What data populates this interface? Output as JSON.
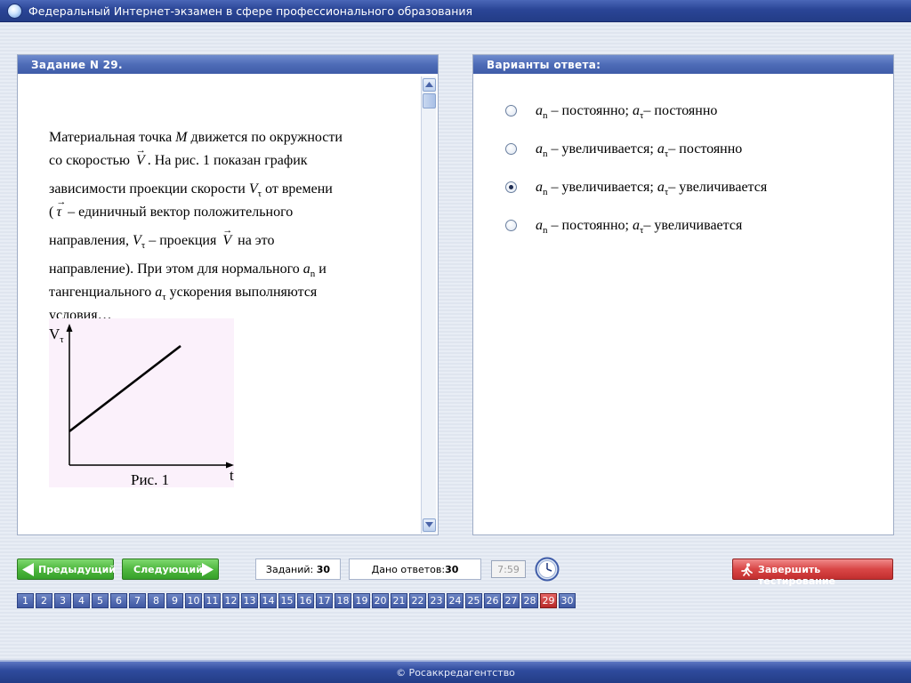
{
  "window": {
    "title": "Федеральный Интернет-экзамен в сфере профессионального образования"
  },
  "task_panel": {
    "header": "Задание N 29.",
    "question": {
      "line1_a": "Материальная точка ",
      "line1_sym": "M",
      "line1_b": " движется по окружности",
      "line2_a": "со скоростью ",
      "line2_vec": "V",
      "line2_b": ". На рис. 1 показан график",
      "line3_a": "зависимости проекции скорости ",
      "line3_sym": "V",
      "line3_sub": "τ",
      "line3_b": "  от времени",
      "line4_a": "(",
      "line4_vec": "τ",
      "line4_b": " – единичный вектор положительного",
      "line5_a": "направления, ",
      "line5_sym": "V",
      "line5_sub": "τ",
      "line5_b": " – проекция ",
      "line5_vec": "V",
      "line5_c": " на это",
      "line6_a": "направление). При этом для нормального ",
      "line6_sym": "a",
      "line6_sub": "n",
      "line6_b": " и",
      "line7_a": "тангенциального ",
      "line7_sym": "a",
      "line7_sub": "τ",
      "line7_b": " ускорения выполняются",
      "line8": "условия…"
    },
    "figure": {
      "y_axis_label": "V",
      "y_axis_sub": "τ",
      "x_axis_label": "t",
      "caption": "Рис. 1"
    }
  },
  "answers_panel": {
    "header": "Варианты ответа:",
    "options": [
      {
        "an_sym": "a",
        "an_sub": "n",
        "an_text": " – постоянно; ",
        "at_sym": "a",
        "at_sub": "τ",
        "at_text": "– постоянно",
        "selected": false
      },
      {
        "an_sym": "a",
        "an_sub": "n",
        "an_text": " – увеличивается; ",
        "at_sym": "a",
        "at_sub": "τ",
        "at_text": "– постоянно",
        "selected": false
      },
      {
        "an_sym": "a",
        "an_sub": "n",
        "an_text": " – увеличивается; ",
        "at_sym": "a",
        "at_sub": "τ",
        "at_text": "– увеличивается",
        "selected": true
      },
      {
        "an_sym": "a",
        "an_sub": "n",
        "an_text": " – постоянно; ",
        "at_sym": "a",
        "at_sub": "τ",
        "at_text": "– увеличивается",
        "selected": false
      }
    ]
  },
  "toolbar": {
    "prev_label": "Предыдущий",
    "next_label": "Следующий",
    "tasks_label": "Заданий: ",
    "tasks_count": "30",
    "answered_label": "Дано ответов:",
    "answered_count": "30",
    "timer": "7:59",
    "finish_label": "Завершить тестирование"
  },
  "pages": {
    "items": [
      "1",
      "2",
      "3",
      "4",
      "5",
      "6",
      "7",
      "8",
      "9",
      "10",
      "11",
      "12",
      "13",
      "14",
      "15",
      "16",
      "17",
      "18",
      "19",
      "20",
      "21",
      "22",
      "23",
      "24",
      "25",
      "26",
      "27",
      "28",
      "29",
      "30"
    ],
    "current": "29"
  },
  "footer": {
    "text": "© Росаккредагентство"
  },
  "colors": {
    "title_bar": "#2a4596",
    "panel_header": "#4e6cb7",
    "nav_button": "#4fb83f",
    "finish_button": "#d94646",
    "current_page": "#b82828",
    "page_button": "#3f58a3",
    "figure_bg": "#fbf1fb"
  },
  "icons": {
    "app": "globe-icon",
    "clock": "clock-icon",
    "finish": "runner-icon",
    "prev": "arrow-left-icon",
    "next": "arrow-right-icon"
  }
}
